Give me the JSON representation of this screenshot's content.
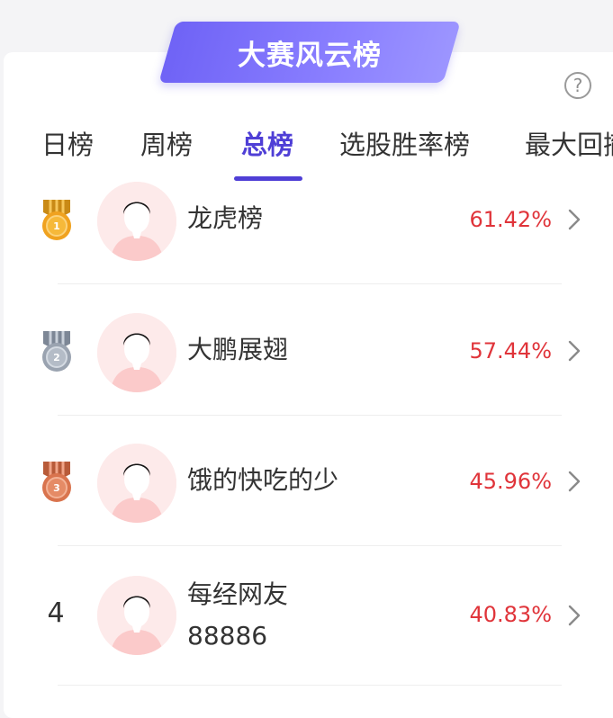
{
  "banner": {
    "title": "大赛风云榜"
  },
  "help_icon": "question-circle-icon",
  "tabs": [
    {
      "label": "日榜"
    },
    {
      "label": "周榜"
    },
    {
      "label": "总榜",
      "active": true
    },
    {
      "label": "选股胜率榜"
    },
    {
      "label": "最大回撤"
    }
  ],
  "rankings": [
    {
      "rank": "1",
      "medal": "gold",
      "name_line1": "龙虎榜",
      "name_line2": "",
      "rate": "61.42%"
    },
    {
      "rank": "2",
      "medal": "silver",
      "name_line1": "大鹏展翅",
      "name_line2": "",
      "rate": "57.44%"
    },
    {
      "rank": "3",
      "medal": "bronze",
      "name_line1": "饿的快吃的少",
      "name_line2": "",
      "rate": "45.96%"
    },
    {
      "rank": "4",
      "medal": "",
      "name_line1": "每经网友",
      "name_line2": "88886",
      "rate": "40.83%"
    }
  ],
  "colors": {
    "accent": "#4f3fd6",
    "rate_red": "#e0343a",
    "gold": "#f0a21f",
    "silver": "#9aa3b0",
    "bronze": "#d9744e"
  }
}
